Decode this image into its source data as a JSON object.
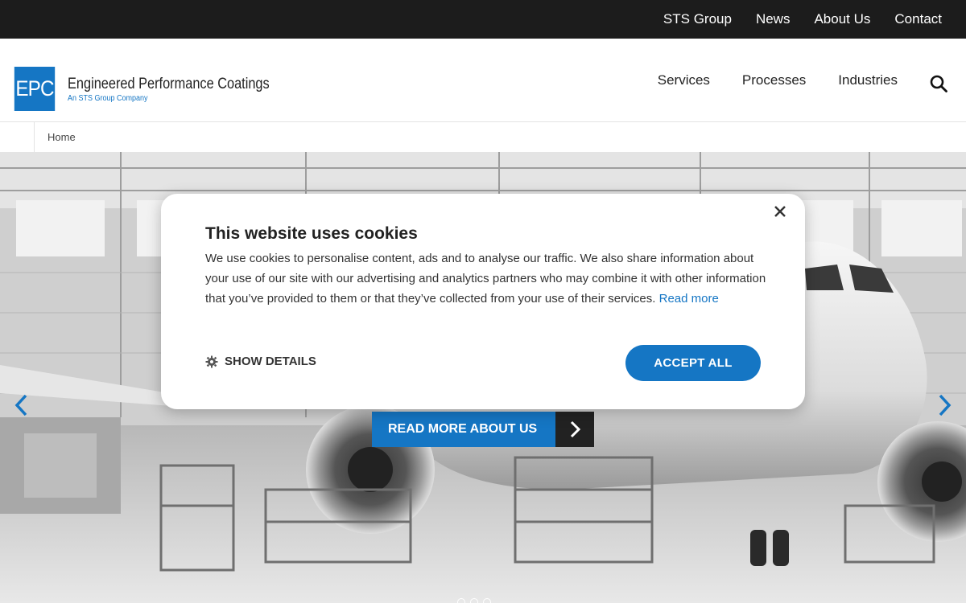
{
  "topbar": {
    "links": [
      {
        "label": "STS Group"
      },
      {
        "label": "News"
      },
      {
        "label": "About Us"
      },
      {
        "label": "Contact"
      }
    ]
  },
  "logo": {
    "mark": "EPC",
    "name": "Engineered Performance Coatings",
    "tagline": "An STS Group Company"
  },
  "mainnav": {
    "items": [
      {
        "label": "Services"
      },
      {
        "label": "Processes"
      },
      {
        "label": "Industries"
      }
    ],
    "search_icon": "search-icon"
  },
  "breadcrumb": {
    "home": "Home"
  },
  "hero": {
    "cta_label": "READ MORE ABOUT US",
    "prev_icon": "chevron-left-icon",
    "next_icon": "chevron-right-icon",
    "slide_count": 3
  },
  "cookie": {
    "title": "This website uses cookies",
    "body": "We use cookies to personalise content, ads and to analyse our traffic. We also share information about your use of our site with our advertising and analytics partners who may combine it with other information that you’ve provided to them or that they’ve collected from your use of their services.",
    "read_more": "Read more",
    "show_details": "SHOW DETAILS",
    "accept_all": "ACCEPT ALL",
    "close_icon": "close-icon",
    "gear_icon": "gear-icon"
  },
  "colors": {
    "brand_blue": "#1576c4",
    "topbar_bg": "#1c1c1c"
  }
}
